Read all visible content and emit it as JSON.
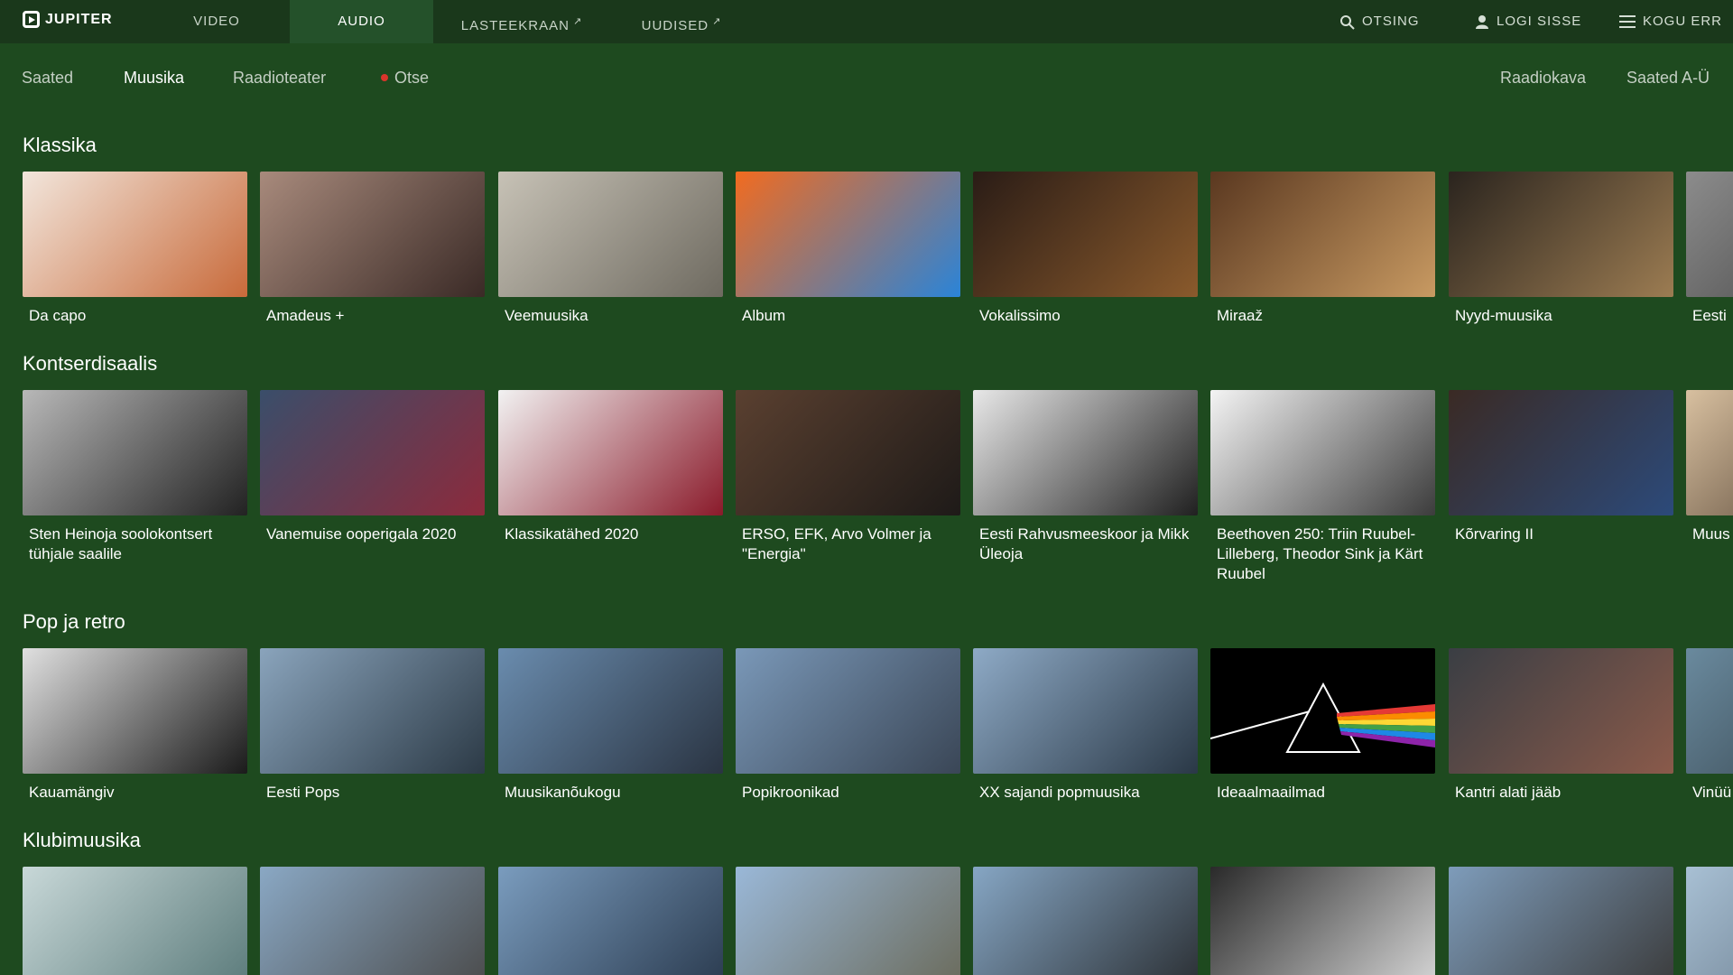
{
  "nav": {
    "logo": "JUPITER",
    "tabs": [
      {
        "label": "VIDEO"
      },
      {
        "label": "AUDIO"
      },
      {
        "label": "LASTEEKRAAN"
      },
      {
        "label": "UUDISED"
      }
    ],
    "search": "OTSING",
    "login": "LOGI SISSE",
    "menu": "KOGU ERR"
  },
  "subnav": {
    "left": [
      "Saated",
      "Muusika",
      "Raadioteater",
      "Otse"
    ],
    "right": [
      "Raadiokava",
      "Saated A-Ü"
    ]
  },
  "sections": [
    {
      "title": "Klassika",
      "items": [
        {
          "label": "Da capo",
          "thumb": [
            "#f2e6dc",
            "#c86a3a"
          ]
        },
        {
          "label": "Amadeus +",
          "thumb": [
            "#a88a7c",
            "#3a2a26"
          ]
        },
        {
          "label": "Veemuusika",
          "thumb": [
            "#c7c2b6",
            "#6e6a60"
          ]
        },
        {
          "label": "Album",
          "thumb": [
            "#f26b1f",
            "#2a84d8"
          ]
        },
        {
          "label": "Vokalissimo",
          "thumb": [
            "#2a1c16",
            "#8a5a2c"
          ]
        },
        {
          "label": "Miraaž",
          "thumb": [
            "#5a3820",
            "#c89a62"
          ]
        },
        {
          "label": "Nyyd-muusika",
          "thumb": [
            "#2a241e",
            "#9c7c52"
          ]
        },
        {
          "label": "Eesti",
          "thumb": [
            "#8c8c8c",
            "#3c3c3c"
          ]
        }
      ]
    },
    {
      "title": "Kontserdisaalis",
      "items": [
        {
          "label": "Sten Heinoja soolokontsert tühjale saalile",
          "thumb": [
            "#b8b8b8",
            "#222222"
          ]
        },
        {
          "label": "Vanemuise ooperigala 2020",
          "thumb": [
            "#3a4e6a",
            "#8c2a3c"
          ]
        },
        {
          "label": "Klassikatähed 2020",
          "thumb": [
            "#f2f2f2",
            "#8a1a2a"
          ]
        },
        {
          "label": "ERSO, EFK, Arvo Volmer ja \"Energia\"",
          "thumb": [
            "#5a4030",
            "#1e1a18"
          ]
        },
        {
          "label": "Eesti Rahvusmeeskoor ja Mikk Üleoja",
          "thumb": [
            "#e8e8e8",
            "#202020"
          ]
        },
        {
          "label": "Beethoven 250: Triin Ruubel-Lilleberg, Theodor Sink ja Kärt Ruubel",
          "thumb": [
            "#f4f4f4",
            "#3c3c3c"
          ]
        },
        {
          "label": "Kõrvaring II",
          "thumb": [
            "#3a2a24",
            "#2c4a7a"
          ]
        },
        {
          "label": "Muus ja Hu",
          "thumb": [
            "#d8c0a0",
            "#3a2a1e"
          ]
        }
      ]
    },
    {
      "title": "Pop ja retro",
      "items": [
        {
          "label": "Kauamängiv",
          "thumb": [
            "#e0e0e0",
            "#1a1a1a"
          ]
        },
        {
          "label": "Eesti Pops",
          "thumb": [
            "#8aa4bc",
            "#2c3a46"
          ]
        },
        {
          "label": "Muusikanõukogu",
          "thumb": [
            "#6a8cae",
            "#2a3442"
          ]
        },
        {
          "label": "Popikroonikad",
          "thumb": [
            "#7a98b8",
            "#3a4656"
          ]
        },
        {
          "label": "XX sajandi popmuusika",
          "thumb": [
            "#8eaac6",
            "#2a3846"
          ]
        },
        {
          "label": "Ideaalmaailmad",
          "thumb": [
            "#000000",
            "#000000"
          ]
        },
        {
          "label": "Kantri alati jääb",
          "thumb": [
            "#3a3e44",
            "#8a5a4a"
          ]
        },
        {
          "label": "Vinüü",
          "thumb": [
            "#6a8a9e",
            "#2e3a42"
          ]
        }
      ]
    },
    {
      "title": "Klubimuusika",
      "items": [
        {
          "label": "",
          "thumb": [
            "#c8d8d8",
            "#5a7a7a"
          ]
        },
        {
          "label": "",
          "thumb": [
            "#8aa8c4",
            "#4a4a4a"
          ]
        },
        {
          "label": "",
          "thumb": [
            "#7a9cbe",
            "#2a3a4e"
          ]
        },
        {
          "label": "",
          "thumb": [
            "#9ab8d8",
            "#6a6a5a"
          ]
        },
        {
          "label": "",
          "thumb": [
            "#86a6c4",
            "#2a2e32"
          ]
        },
        {
          "label": "",
          "thumb": [
            "#2a2a2a",
            "#d8d8d8"
          ]
        },
        {
          "label": "",
          "thumb": [
            "#7e9cba",
            "#3a3a3a"
          ]
        },
        {
          "label": "",
          "thumb": [
            "#a8c0d4",
            "#5a6a7a"
          ]
        }
      ]
    }
  ]
}
